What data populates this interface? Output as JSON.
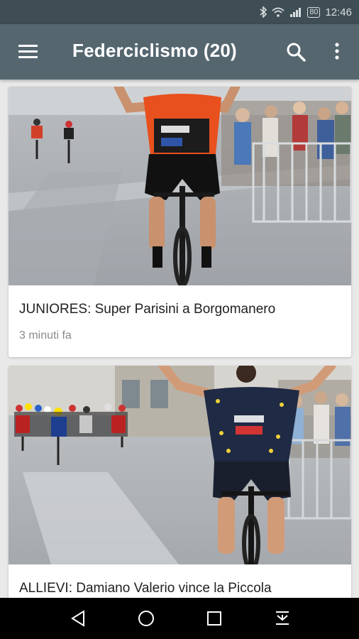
{
  "status_bar": {
    "icons": [
      "bluetooth-icon",
      "wifi-icon",
      "signal-icon",
      "battery-icon"
    ],
    "battery": "80",
    "time": "12:46"
  },
  "app_bar": {
    "title": "Federciclismo (20)",
    "icons": [
      "menu-icon",
      "search-icon",
      "more-vert-icon"
    ]
  },
  "articles": [
    {
      "title": "JUNIORES: Super Parisini a Borgomanero",
      "time": "3 minuti fa",
      "image": "cyclist-celebrating-finish-photo"
    },
    {
      "title": "ALLIEVI: Damiano Valerio vince la Piccola",
      "image": "cyclist-celebrating-finish-photo"
    }
  ],
  "nav_bar": {
    "icons": [
      "back-icon",
      "home-icon",
      "recents-icon",
      "notifications-pull-icon"
    ]
  },
  "colors": {
    "status_bar": "#3f4d55",
    "app_bar": "#55666f",
    "background": "#e9e9e9",
    "jersey_orange": "#e8501e",
    "jersey_dark": "#1f2a44"
  }
}
